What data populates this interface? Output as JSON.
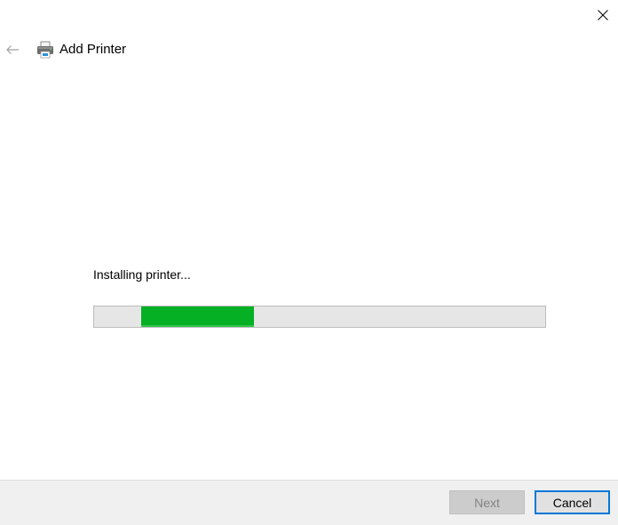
{
  "window": {
    "close_icon": "close-icon"
  },
  "header": {
    "back_icon": "back-arrow-icon",
    "app_icon": "printer-icon",
    "title": "Add Printer"
  },
  "main": {
    "status_text": "Installing printer...",
    "progress": {
      "mode": "indeterminate",
      "segment_start_fraction": 0.104,
      "segment_end_fraction": 0.354,
      "fill_color": "#06b025",
      "track_color": "#e6e6e6"
    }
  },
  "footer": {
    "next_label": "Next",
    "next_enabled": false,
    "cancel_label": "Cancel",
    "accent_color": "#0078d7"
  }
}
